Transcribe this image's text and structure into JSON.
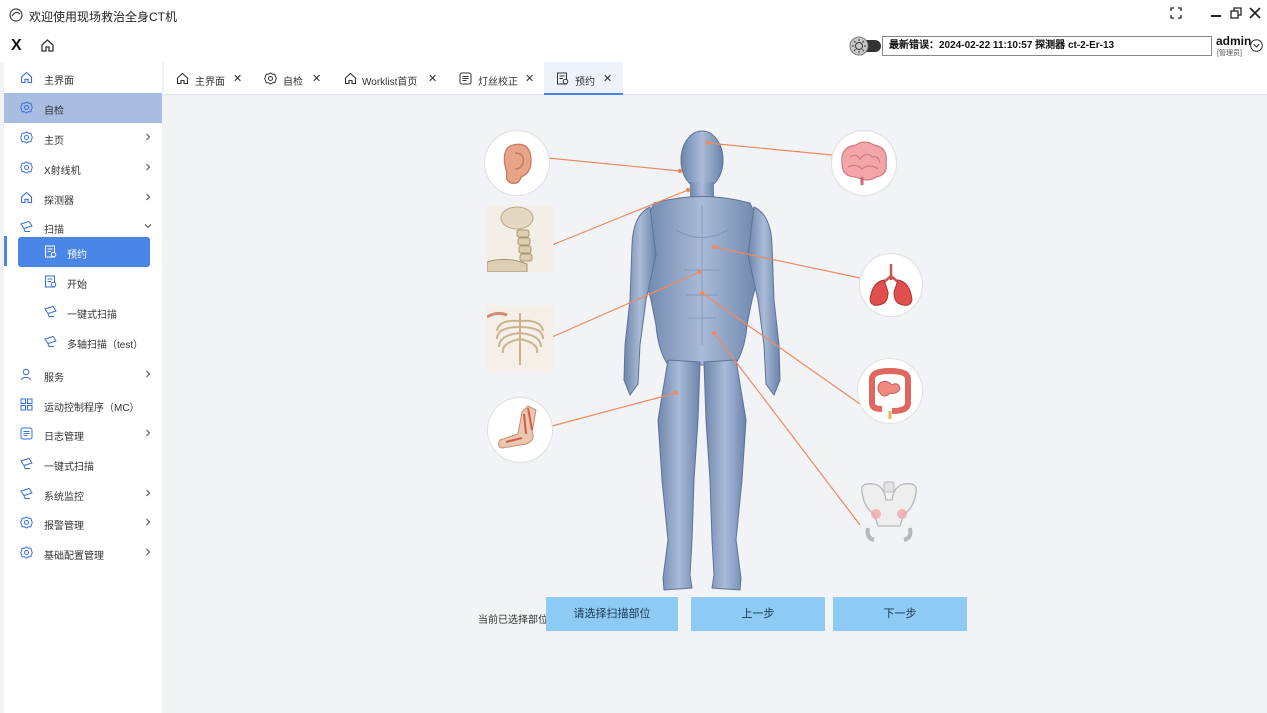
{
  "window": {
    "title": "欢迎使用现场救治全身CT机"
  },
  "toolbar": {
    "logo_text": "X",
    "status_text": "最新错误：2024-02-22 11:10:57  探测器  ct-2-Er-13",
    "user_name": "admin",
    "user_role": "[管理员]"
  },
  "sidebar": {
    "items": [
      {
        "label": "主界面",
        "icon": "home-icon"
      },
      {
        "label": "自检",
        "icon": "gear-icon"
      },
      {
        "label": "主页",
        "icon": "gear-icon"
      },
      {
        "label": "X射线机",
        "icon": "gear-icon"
      },
      {
        "label": "探测器",
        "icon": "home-icon"
      },
      {
        "label": "扫描",
        "icon": "scanner-icon"
      },
      {
        "label": "预约",
        "icon": "document-icon"
      },
      {
        "label": "开始",
        "icon": "document-icon"
      },
      {
        "label": "一键式扫描",
        "icon": "scanner-icon"
      },
      {
        "label": "多轴扫描（test）",
        "icon": "scanner-icon"
      },
      {
        "label": "服务",
        "icon": "user-icon"
      },
      {
        "label": "运动控制程序（MC）",
        "icon": "grid-icon"
      },
      {
        "label": "日志管理",
        "icon": "list-icon"
      },
      {
        "label": "一键式扫描",
        "icon": "scanner-icon"
      },
      {
        "label": "系统监控",
        "icon": "scanner-icon"
      },
      {
        "label": "报警管理",
        "icon": "gear-icon"
      },
      {
        "label": "基础配置管理",
        "icon": "gear-icon"
      }
    ]
  },
  "tabs": [
    {
      "label": "主界面",
      "icon": "home-icon"
    },
    {
      "label": "自检",
      "icon": "gear-icon"
    },
    {
      "label": "Worklist首页",
      "icon": "home-icon"
    },
    {
      "label": "灯丝校正",
      "icon": "list-icon"
    },
    {
      "label": "预约",
      "icon": "document-icon"
    }
  ],
  "active_tab": "预约",
  "main": {
    "selected_label": "当前已选择部位:",
    "select_button": "请选择扫描部位",
    "prev_button": "上一步",
    "next_button": "下一步",
    "body_parts": [
      "ear",
      "neck",
      "chest-skeleton",
      "foot",
      "brain",
      "lungs",
      "intestines",
      "pelvis"
    ]
  },
  "colors": {
    "accent": "#4a86e8",
    "sidebar_selected": "#a9bde3",
    "button": "#8dcaf4",
    "connector": "#f08a5d",
    "body": "#8fa6c8"
  }
}
